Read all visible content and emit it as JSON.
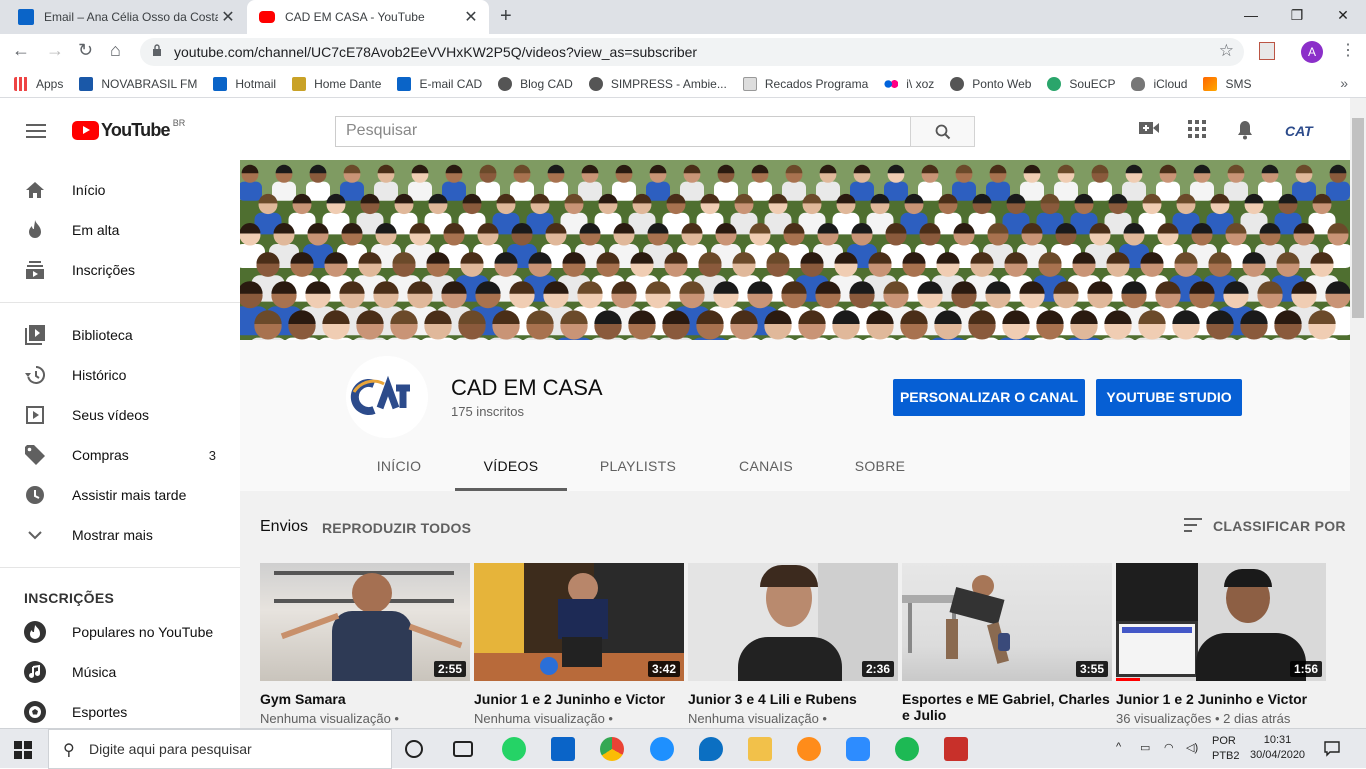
{
  "browser": {
    "tabs": [
      {
        "title": "Email – Ana Célia Osso da Costa",
        "icon": "outlook-icon",
        "color": "#0a64c8"
      },
      {
        "title": "CAD EM CASA - YouTube",
        "icon": "youtube-icon",
        "color": "#ff0000"
      }
    ],
    "url": "youtube.com/channel/UC7cE78Avob2EeVVHxKW2P5Q/videos?view_as=subscriber",
    "account_letter": "A",
    "bookmarks": [
      "Apps",
      "NOVABRASIL FM",
      "Hotmail",
      "Home Dante",
      "E-mail CAD",
      "Blog CAD",
      "SIMPRESS - Ambie...",
      "Recados Programa",
      "i\\ xoz",
      "Ponto Web",
      "SouECP",
      "iCloud",
      "SMS"
    ]
  },
  "youtube": {
    "logo_text": "YouTube",
    "region": "BR",
    "search_placeholder": "Pesquisar",
    "sidebar": {
      "main": [
        {
          "label": "Início",
          "icon": "home-icon"
        },
        {
          "label": "Em alta",
          "icon": "trending-flame-icon"
        },
        {
          "label": "Inscrições",
          "icon": "subscriptions-icon"
        }
      ],
      "library": [
        {
          "label": "Biblioteca",
          "icon": "library-icon"
        },
        {
          "label": "Histórico",
          "icon": "history-icon"
        },
        {
          "label": "Seus vídeos",
          "icon": "your-videos-icon"
        },
        {
          "label": "Compras",
          "icon": "tag-icon",
          "count": "3"
        },
        {
          "label": "Assistir mais tarde",
          "icon": "clock-icon"
        },
        {
          "label": "Mostrar mais",
          "icon": "chevron-down-icon"
        }
      ],
      "subscriptions_heading": "INSCRIÇÕES",
      "subscriptions": [
        {
          "label": "Populares no YouTube"
        },
        {
          "label": "Música"
        },
        {
          "label": "Esportes"
        }
      ]
    },
    "channel": {
      "name": "CAD EM CASA",
      "subscribers": "175 inscritos",
      "btn_customize": "PERSONALIZAR O CANAL",
      "btn_studio": "YOUTUBE STUDIO",
      "tabs": [
        "INÍCIO",
        "VÍDEOS",
        "PLAYLISTS",
        "CANAIS",
        "SOBRE"
      ],
      "active_tab": "VÍDEOS"
    },
    "uploads": {
      "heading": "Envios",
      "play_all": "REPRODUZIR TODOS",
      "sort": "CLASSIFICAR POR",
      "videos": [
        {
          "title": "Gym Samara",
          "duration": "2:55",
          "meta": "Nenhuma visualização •"
        },
        {
          "title": "Junior 1 e 2 Juninho e Victor",
          "duration": "3:42",
          "meta": "Nenhuma visualização •"
        },
        {
          "title": "Junior 3 e 4 Lili e Rubens",
          "duration": "2:36",
          "meta": "Nenhuma visualização •"
        },
        {
          "title": "Esportes e ME Gabriel, Charles e Julio",
          "duration": "3:55",
          "meta": ""
        },
        {
          "title": "Junior 1 e 2 Juninho e Victor",
          "duration": "1:56",
          "meta": "36 visualizações • 2 dias atrás"
        }
      ]
    }
  },
  "taskbar": {
    "search_placeholder": "Digite aqui para pesquisar",
    "lang": "POR",
    "lang2": "PTB2",
    "time": "10:31",
    "date": "30/04/2020"
  }
}
